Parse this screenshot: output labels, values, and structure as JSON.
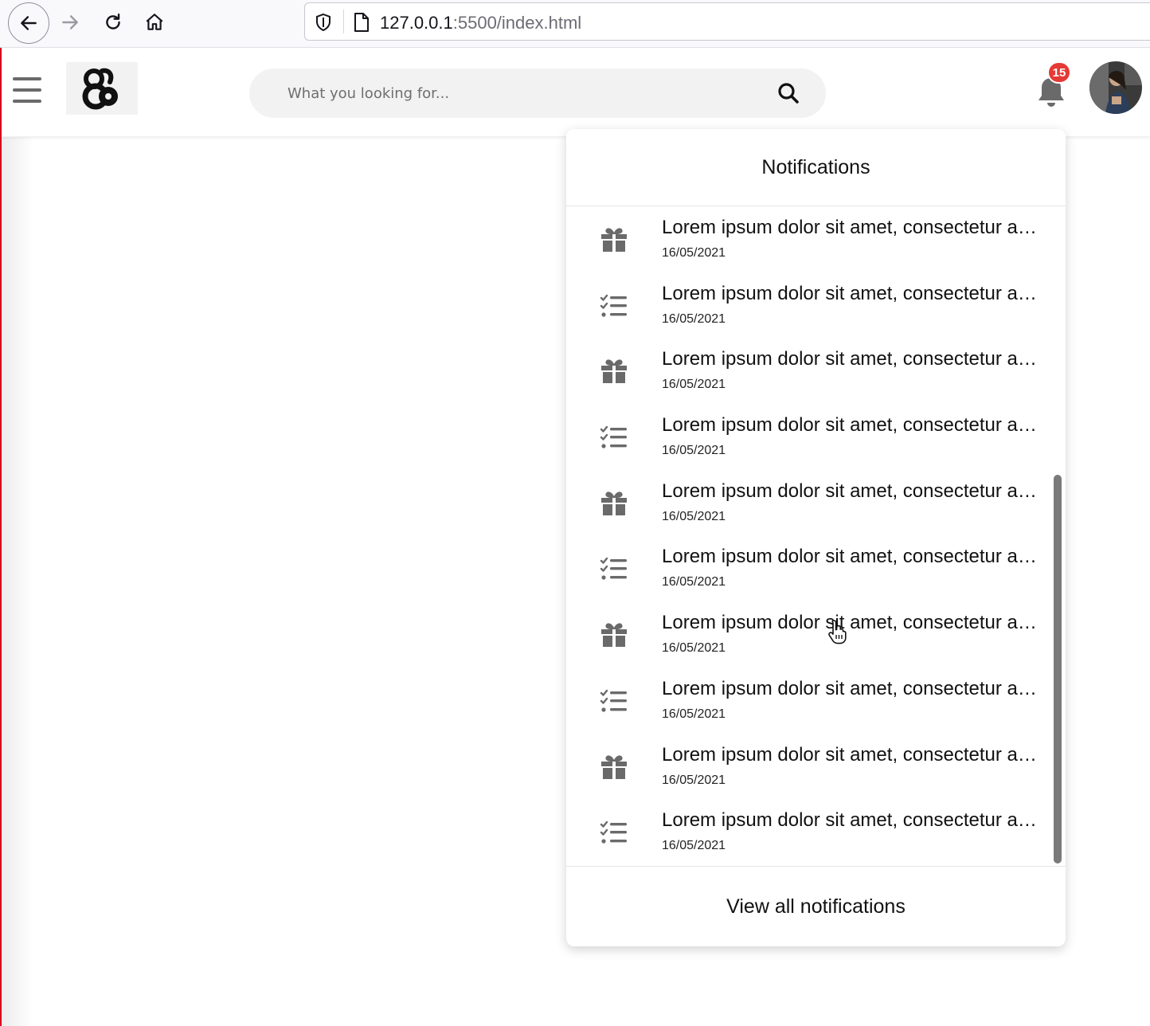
{
  "browser": {
    "url_host": "127.0.0.1",
    "url_rest": ":5500/index.html"
  },
  "header": {
    "search_placeholder": "What you looking for...",
    "notification_count": "15"
  },
  "notifications": {
    "title": "Notifications",
    "items": [
      {
        "icon": "gift-icon",
        "title": "Lorem ipsum dolor sit amet, consectetur adipiscing elit",
        "date": "16/05/2021"
      },
      {
        "icon": "checklist-icon",
        "title": "Lorem ipsum dolor sit amet, consectetur adipiscing elit",
        "date": "16/05/2021"
      },
      {
        "icon": "gift-icon",
        "title": "Lorem ipsum dolor sit amet, consectetur adipiscing elit",
        "date": "16/05/2021"
      },
      {
        "icon": "checklist-icon",
        "title": "Lorem ipsum dolor sit amet, consectetur adipiscing elit",
        "date": "16/05/2021"
      },
      {
        "icon": "gift-icon",
        "title": "Lorem ipsum dolor sit amet, consectetur adipiscing elit",
        "date": "16/05/2021"
      },
      {
        "icon": "checklist-icon",
        "title": "Lorem ipsum dolor sit amet, consectetur adipiscing elit",
        "date": "16/05/2021"
      },
      {
        "icon": "gift-icon",
        "title": "Lorem ipsum dolor sit amet, consectetur adipiscing elit",
        "date": "16/05/2021"
      },
      {
        "icon": "checklist-icon",
        "title": "Lorem ipsum dolor sit amet, consectetur adipiscing elit",
        "date": "16/05/2021"
      },
      {
        "icon": "gift-icon",
        "title": "Lorem ipsum dolor sit amet, consectetur adipiscing elit",
        "date": "16/05/2021"
      },
      {
        "icon": "checklist-icon",
        "title": "Lorem ipsum dolor sit amet, consectetur adipiscing elit",
        "date": "16/05/2021"
      }
    ],
    "footer_label": "View all notifications"
  },
  "colors": {
    "badge": "#e53935",
    "icon_gray": "#6a6a6a",
    "search_bg": "#f2f2f2",
    "browser_edge": "#d70022"
  }
}
